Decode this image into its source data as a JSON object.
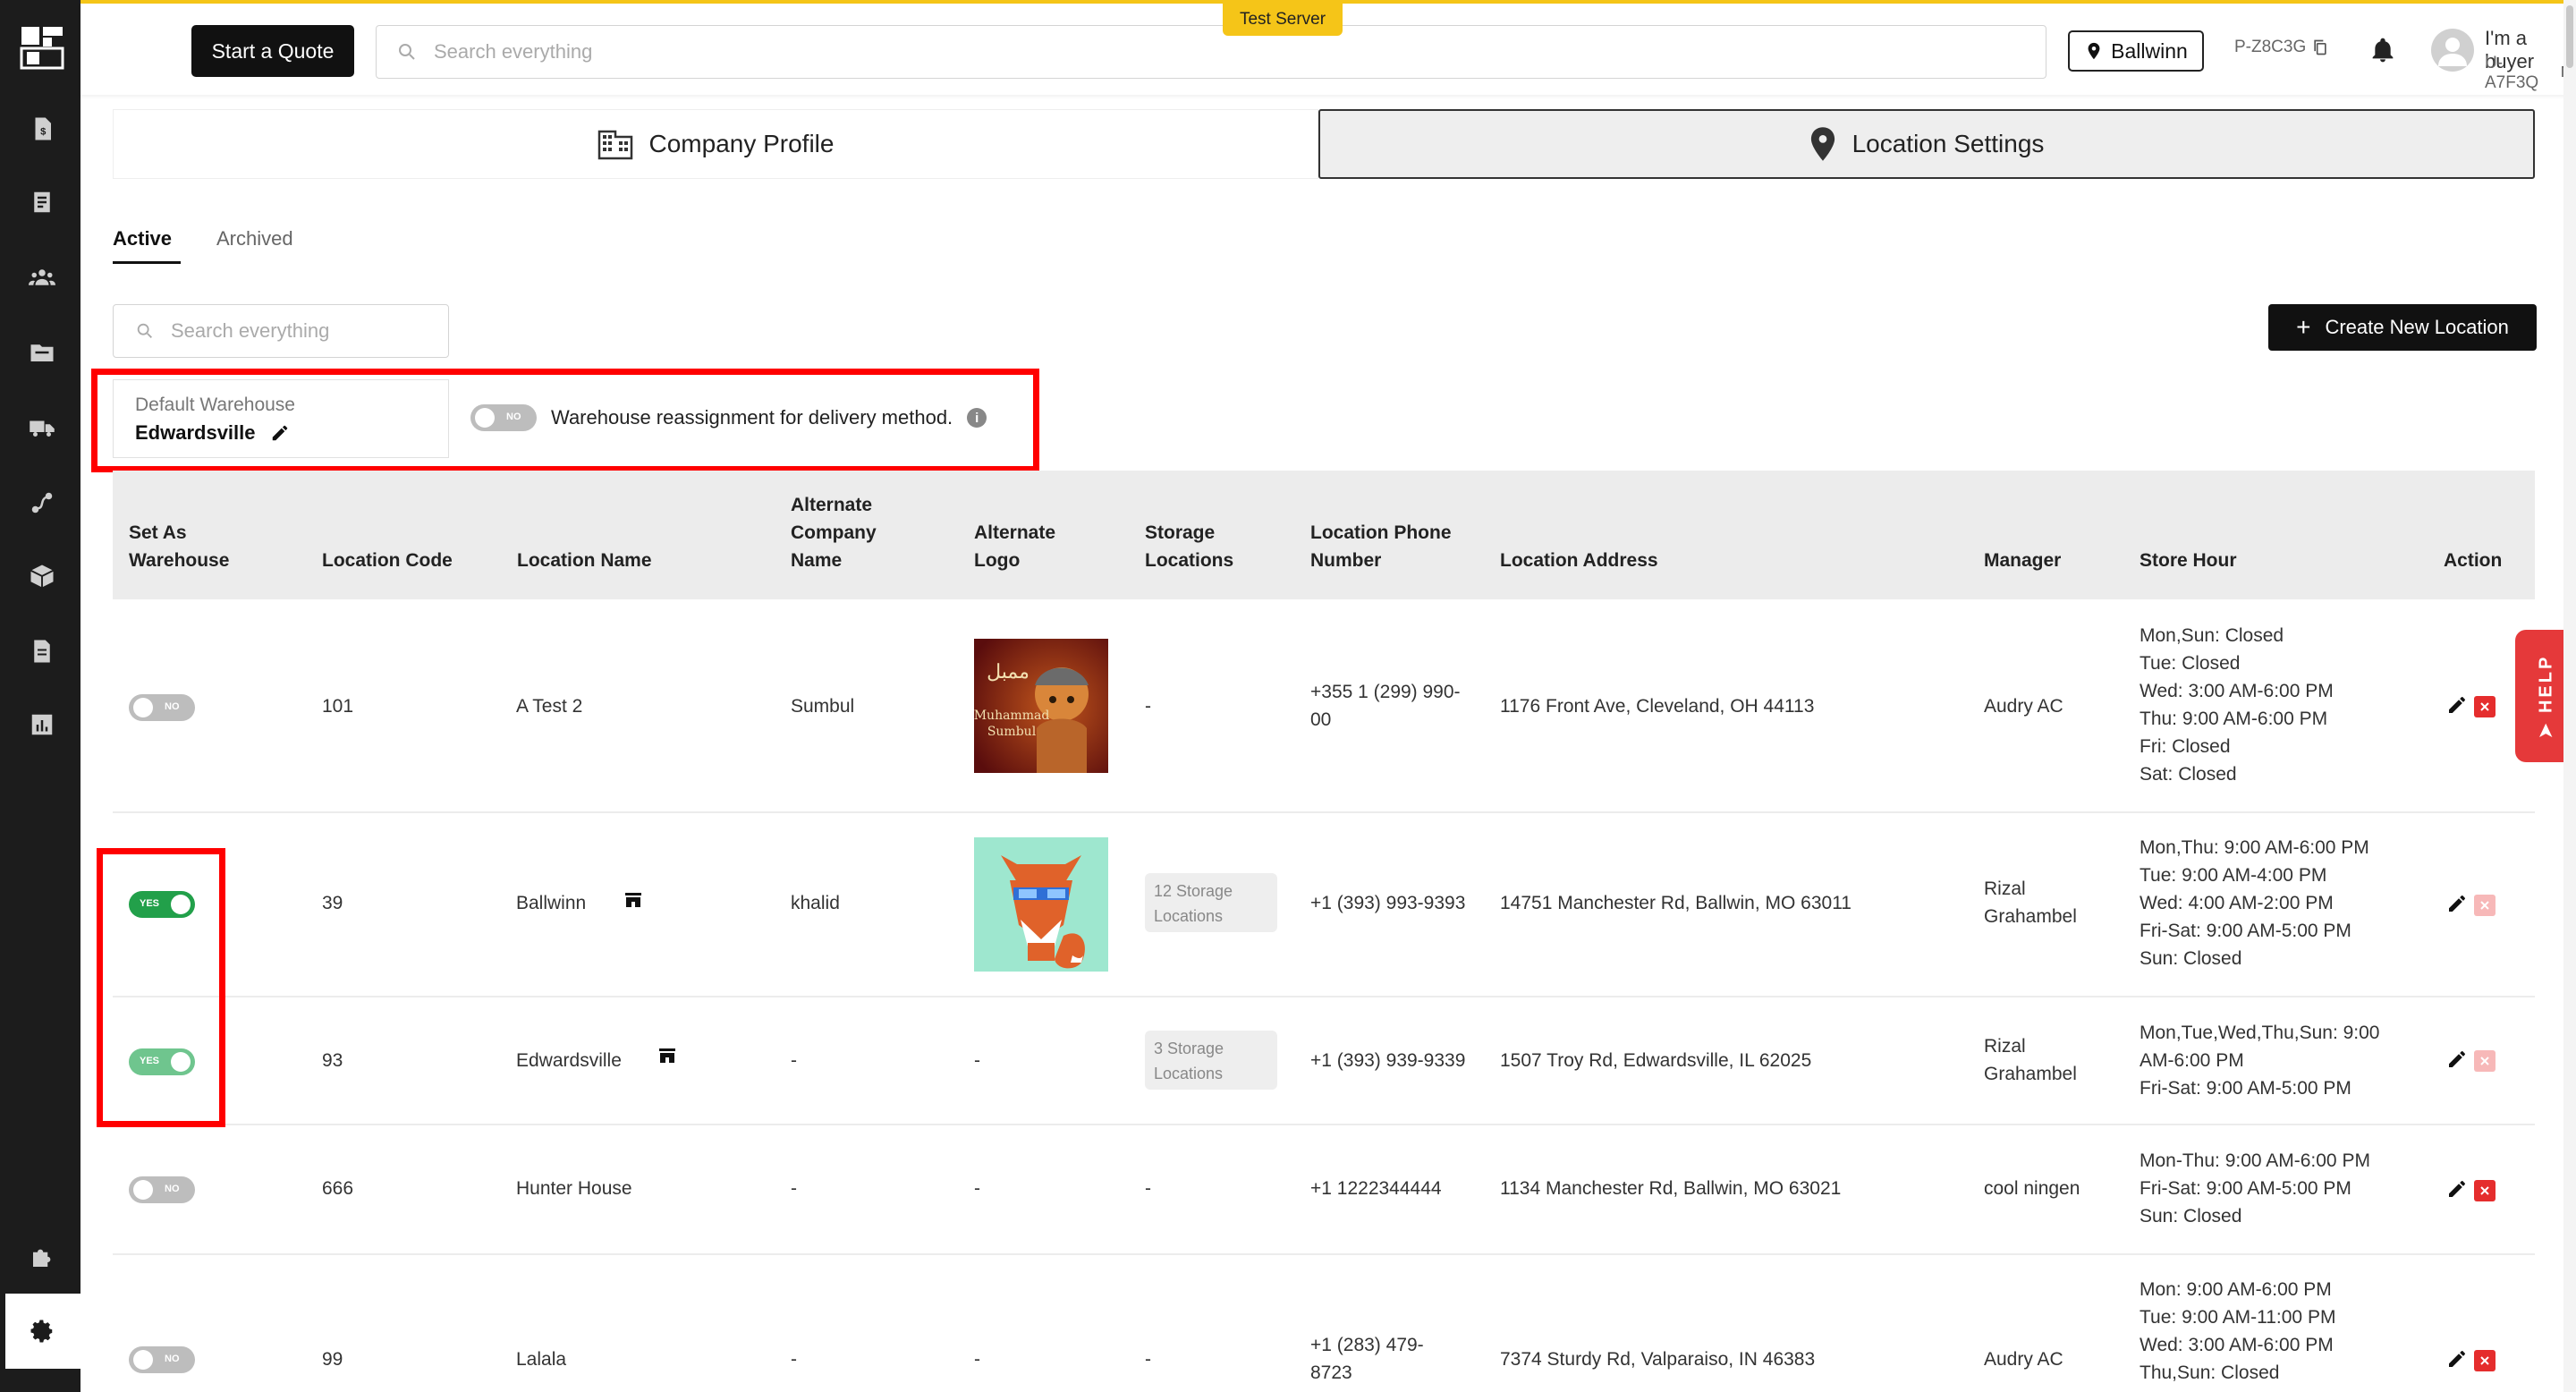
{
  "header": {
    "quote_button": "Start a Quote",
    "search_placeholder": "Search everything",
    "server_badge": "Test Server",
    "location_button": "Ballwinn",
    "p_code": "P-Z8C3G",
    "buyer_label": "I'm a buyer",
    "u_code": "U-A7F3Q"
  },
  "sidebar": {
    "icons": [
      "dollar-doc-icon",
      "receipt-icon",
      "users-icon",
      "folder-icon",
      "truck-icon",
      "route-icon",
      "box-icon",
      "document-icon",
      "chart-icon",
      "puzzle-icon",
      "settings-icon"
    ]
  },
  "tabs": {
    "company_profile": "Company Profile",
    "location_settings": "Location Settings"
  },
  "subtabs": {
    "active": "Active",
    "archived": "Archived"
  },
  "list": {
    "search_placeholder": "Search everything",
    "create_button": "Create New Location"
  },
  "default_warehouse": {
    "label": "Default Warehouse",
    "value": "Edwardsville",
    "reassign_toggle": "NO",
    "reassign_label": "Warehouse reassignment for delivery method."
  },
  "table": {
    "headers": {
      "set_as_warehouse": [
        "Set As",
        "Warehouse"
      ],
      "location_code": "Location Code",
      "location_name": "Location Name",
      "alt_company": [
        "Alternate",
        "Company",
        "Name"
      ],
      "alt_logo": [
        "Alternate",
        "Logo"
      ],
      "storage": [
        "Storage",
        "Locations"
      ],
      "phone": [
        "Location Phone",
        "Number"
      ],
      "address": "Location Address",
      "manager": "Manager",
      "store_hour": "Store Hour",
      "action": "Action"
    },
    "rows": [
      {
        "toggle": "NO",
        "code": "101",
        "name": "A Test 2",
        "alt_company": "Sumbul",
        "storage": "-",
        "phone": [
          "+355 1 (299) 990-",
          "00"
        ],
        "address": "1176 Front Ave, Cleveland, OH 44113",
        "manager": [
          "Audry AC"
        ],
        "hours": [
          "Mon,Sun: Closed",
          "Tue: Closed",
          "Wed: 3:00 AM-6:00 PM",
          "Thu: 9:00 AM-6:00 PM",
          "Fri: Closed",
          "Sat: Closed"
        ],
        "logo_text": [
          "ممبل",
          "Muhammad",
          "Sumbul"
        ]
      },
      {
        "toggle": "YES",
        "code": "39",
        "name": "Ballwinn",
        "alt_company": "khalid",
        "storage": [
          "12 Storage",
          "Locations"
        ],
        "phone": [
          "+1 (393) 993-9393"
        ],
        "address": "14751 Manchester Rd, Ballwin, MO 63011",
        "manager": [
          "Rizal",
          "Grahambel"
        ],
        "hours": [
          "Mon,Thu: 9:00 AM-6:00 PM",
          "Tue: 9:00 AM-4:00 PM",
          "Wed: 4:00 AM-2:00 PM",
          "Fri-Sat: 9:00 AM-5:00 PM",
          "Sun: Closed"
        ]
      },
      {
        "toggle": "YES",
        "code": "93",
        "name": "Edwardsville",
        "alt_company": "-",
        "alt_logo": "-",
        "storage": [
          "3 Storage",
          "Locations"
        ],
        "phone": [
          "+1 (393) 939-9339"
        ],
        "address": "1507 Troy Rd, Edwardsville, IL 62025",
        "manager": [
          "Rizal",
          "Grahambel"
        ],
        "hours": [
          "Mon,Tue,Wed,Thu,Sun: 9:00",
          "AM-6:00 PM",
          "Fri-Sat: 9:00 AM-5:00 PM"
        ]
      },
      {
        "toggle": "NO",
        "code": "666",
        "name": "Hunter House",
        "alt_company": "-",
        "alt_logo": "-",
        "storage": "-",
        "phone": [
          "+1 1222344444"
        ],
        "address": "1134 Manchester Rd, Ballwin, MO 63021",
        "manager": [
          "cool ningen"
        ],
        "hours": [
          "Mon-Thu: 9:00 AM-6:00 PM",
          "Fri-Sat: 9:00 AM-5:00 PM",
          "Sun: Closed"
        ]
      },
      {
        "toggle": "NO",
        "code": "99",
        "name": "Lalala",
        "alt_company": "-",
        "alt_logo": "-",
        "storage": "-",
        "phone": [
          "+1 (283) 479-",
          "8723"
        ],
        "address": "7374 Sturdy Rd, Valparaiso, IN 46383",
        "manager": [
          "Audry AC"
        ],
        "hours": [
          "Mon: 9:00 AM-6:00 PM",
          "Tue: 9:00 AM-11:00 PM",
          "Wed: 3:00 AM-6:00 PM",
          "Thu,Sun: Closed"
        ]
      }
    ]
  },
  "help_tab": "HELP",
  "colors": {
    "accent": "#f5c518",
    "highlight": "#ff0000",
    "toggle_on": "#22a04a",
    "delete": "#e52d2d",
    "sidebar": "#1c1c1c"
  }
}
